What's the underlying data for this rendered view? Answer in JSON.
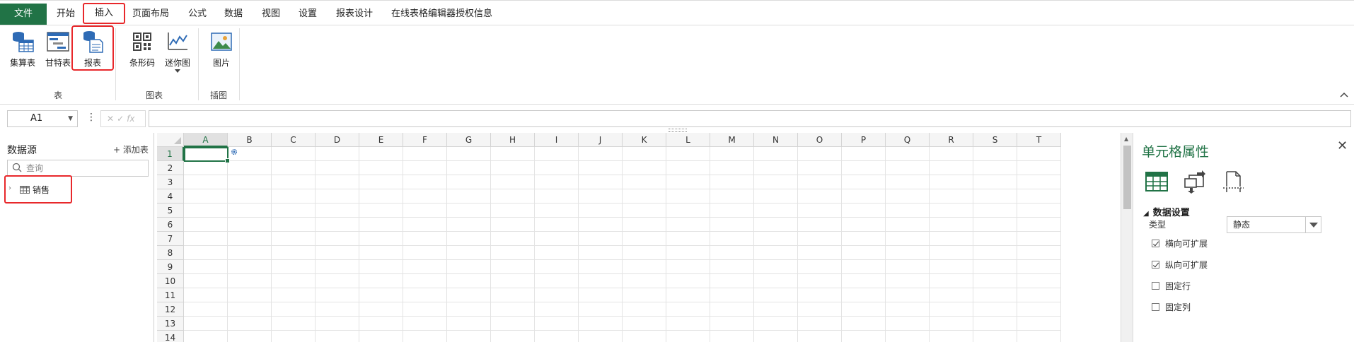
{
  "tabs": [
    {
      "label": "文件"
    },
    {
      "label": "开始"
    },
    {
      "label": "插入"
    },
    {
      "label": "页面布局"
    },
    {
      "label": "公式"
    },
    {
      "label": "数据"
    },
    {
      "label": "视图"
    },
    {
      "label": "设置"
    },
    {
      "label": "报表设计"
    },
    {
      "label": "在线表格编辑器授权信息"
    }
  ],
  "active_tab": "插入",
  "ribbon": {
    "buttons": [
      {
        "label": "集算表",
        "icon": "db-table-icon"
      },
      {
        "label": "甘特表",
        "icon": "gantt-icon"
      },
      {
        "label": "报表",
        "icon": "report-icon"
      },
      {
        "label": "条形码",
        "icon": "qrcode-icon"
      },
      {
        "label": "迷你图",
        "icon": "sparkline-icon"
      },
      {
        "label": "图片",
        "icon": "picture-icon"
      }
    ],
    "groups": [
      {
        "label": "表"
      },
      {
        "label": "图表"
      },
      {
        "label": "插图"
      }
    ]
  },
  "formula_bar": {
    "name_box": "A1",
    "cancel_symbol": "✕",
    "confirm_symbol": "✓",
    "fx_symbol": "fx",
    "value": ""
  },
  "datasource": {
    "title": "数据源",
    "add_table": "+ 添加表",
    "search_placeholder": "查询",
    "items": [
      {
        "label": "销售"
      }
    ]
  },
  "grid": {
    "columns": [
      "A",
      "B",
      "C",
      "D",
      "E",
      "F",
      "G",
      "H",
      "I",
      "J",
      "K",
      "L",
      "M",
      "N",
      "O",
      "P",
      "Q",
      "R",
      "S",
      "T"
    ],
    "rows": [
      "1",
      "2",
      "3",
      "4",
      "5",
      "6",
      "7",
      "8",
      "9",
      "10",
      "11",
      "12",
      "13",
      "14"
    ],
    "active_cell": "A1"
  },
  "properties": {
    "title": "单元格属性",
    "section": "数据设置",
    "type_label": "类型",
    "type_value": "静态",
    "checkboxes": [
      {
        "label": "横向可扩展",
        "checked": true
      },
      {
        "label": "纵向可扩展",
        "checked": true
      },
      {
        "label": "固定行",
        "checked": false
      },
      {
        "label": "固定列",
        "checked": false
      }
    ]
  },
  "colors": {
    "accent": "#217346",
    "highlight": "#e8282b",
    "icon_blue": "#2e6bb5"
  }
}
